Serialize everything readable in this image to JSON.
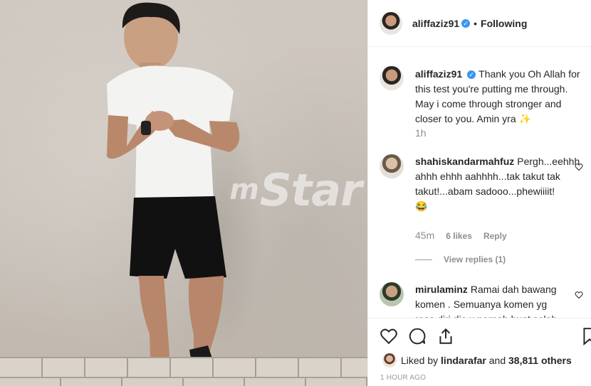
{
  "photo": {
    "watermark_prefix": "m",
    "watermark_text": "Star"
  },
  "header": {
    "username": "aliffaziz91",
    "separator": "•",
    "follow_status": "Following"
  },
  "caption": {
    "username": "aliffaziz91",
    "text": "Thank you Oh Allah for this test you're putting me through. May i come through stronger and closer to you. Amin yra ✨",
    "time": "1h"
  },
  "comments": [
    {
      "username": "shahiskandarmahfuz",
      "text": "Pergh...eehhh ahhh ehhh aahhhh...tak takut tak takut!...abam sadooo...phewiiiit! 😂",
      "time": "45m",
      "likes": "6 likes",
      "reply": "Reply",
      "view_replies": "View replies (1)"
    },
    {
      "username": "mirulaminz",
      "text": "Ramai dah bawang komen . Semuanya komen yg rasa diri dia x pernah buat salah"
    }
  ],
  "footer": {
    "liked_by_prefix": "Liked by",
    "liked_by_user": "lindarafar",
    "and": "and",
    "others": "38,811 others",
    "timestamp": "1 HOUR AGO"
  },
  "colors": {
    "link_blue": "#3897f0",
    "muted": "#8e8e8e",
    "text": "#262626"
  }
}
